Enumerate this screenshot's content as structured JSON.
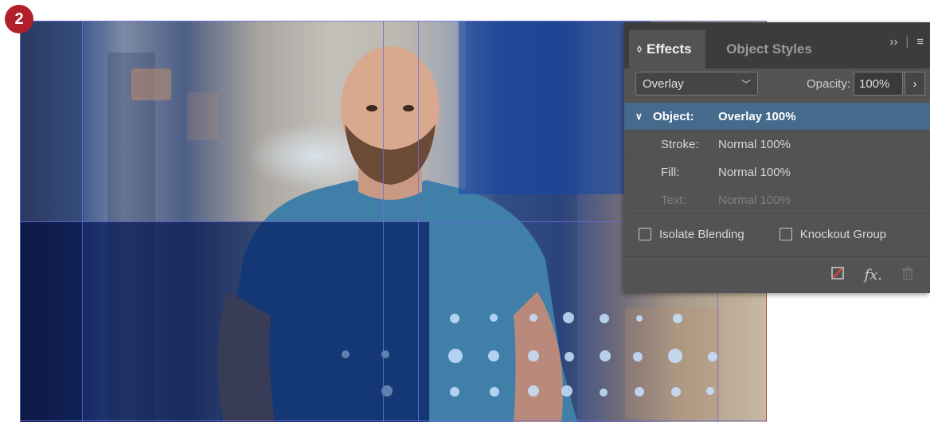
{
  "badge": {
    "number": "2"
  },
  "panel": {
    "tabs": {
      "effects": "Effects",
      "object_styles": "Object Styles"
    },
    "tab_tools": {
      "expand": "››",
      "menu": "≡"
    },
    "blend_mode": "Overlay",
    "opacity_label": "Opacity:",
    "opacity_value": "100%",
    "rows": [
      {
        "label": "Object:",
        "value": "Overlay 100%",
        "selected": true
      },
      {
        "label": "Stroke:",
        "value": "Normal 100%"
      },
      {
        "label": "Fill:",
        "value": "Normal 100%"
      },
      {
        "label": "Text:",
        "value": "Normal 100%",
        "disabled": true
      }
    ],
    "checkboxes": {
      "isolate_blending": "Isolate Blending",
      "knockout_group": "Knockout Group"
    },
    "footer_icons": [
      "clear-effects-icon",
      "fx-icon",
      "trash-icon"
    ],
    "fx_label": "fx."
  },
  "colors": {
    "panel_bg": "#535353",
    "selected_row": "#466a8c",
    "badge": "#b21f2c",
    "overlay_blue": "#0a3796"
  }
}
